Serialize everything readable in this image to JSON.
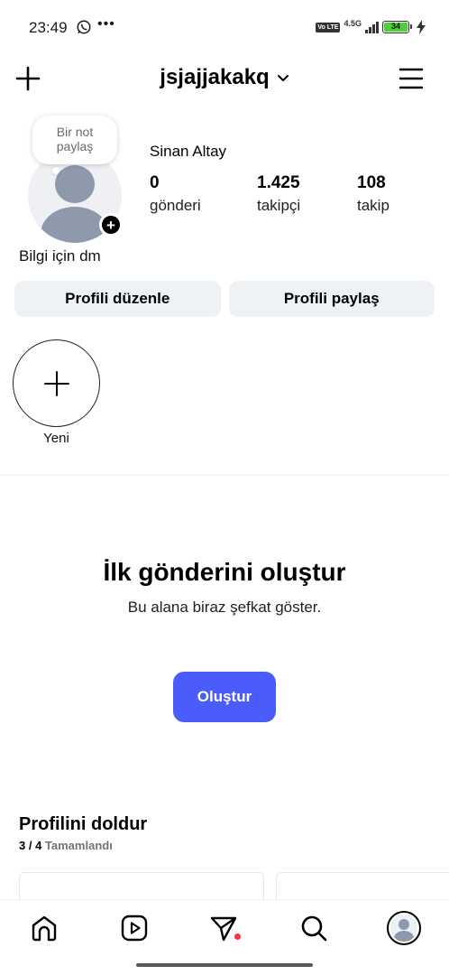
{
  "status_bar": {
    "time": "23:49",
    "more": "•••",
    "volte": "Vo LTE",
    "network": "4.5G",
    "battery": "34",
    "icons": [
      "whatsapp-icon",
      "signal-icon",
      "battery-icon",
      "charging-icon"
    ]
  },
  "header": {
    "username": "jsjajjakakq"
  },
  "profile": {
    "note_line1": "Bir not",
    "note_line2": "paylaş",
    "full_name": "Sinan Altay",
    "bio": "Bilgi için dm",
    "stats": {
      "posts_count": "0",
      "posts_label": "gönderi",
      "followers_count": "1.425",
      "followers_label": "takipçi",
      "following_count": "108",
      "following_label": "takip"
    },
    "edit_button": "Profili düzenle",
    "share_button": "Profili paylaş"
  },
  "highlights": {
    "new_label": "Yeni"
  },
  "empty_state": {
    "title": "İlk gönderini oluştur",
    "subtitle": "Bu alana biraz şefkat göster.",
    "button": "Oluştur"
  },
  "complete_profile": {
    "title": "Profilini doldur",
    "count": "3 / 4",
    "status": "Tamamlandı"
  },
  "colors": {
    "accent": "#4a5dfb",
    "button_gray": "#eff2f5",
    "notification_dot": "#ff3040",
    "battery_fill": "#4cd137"
  }
}
